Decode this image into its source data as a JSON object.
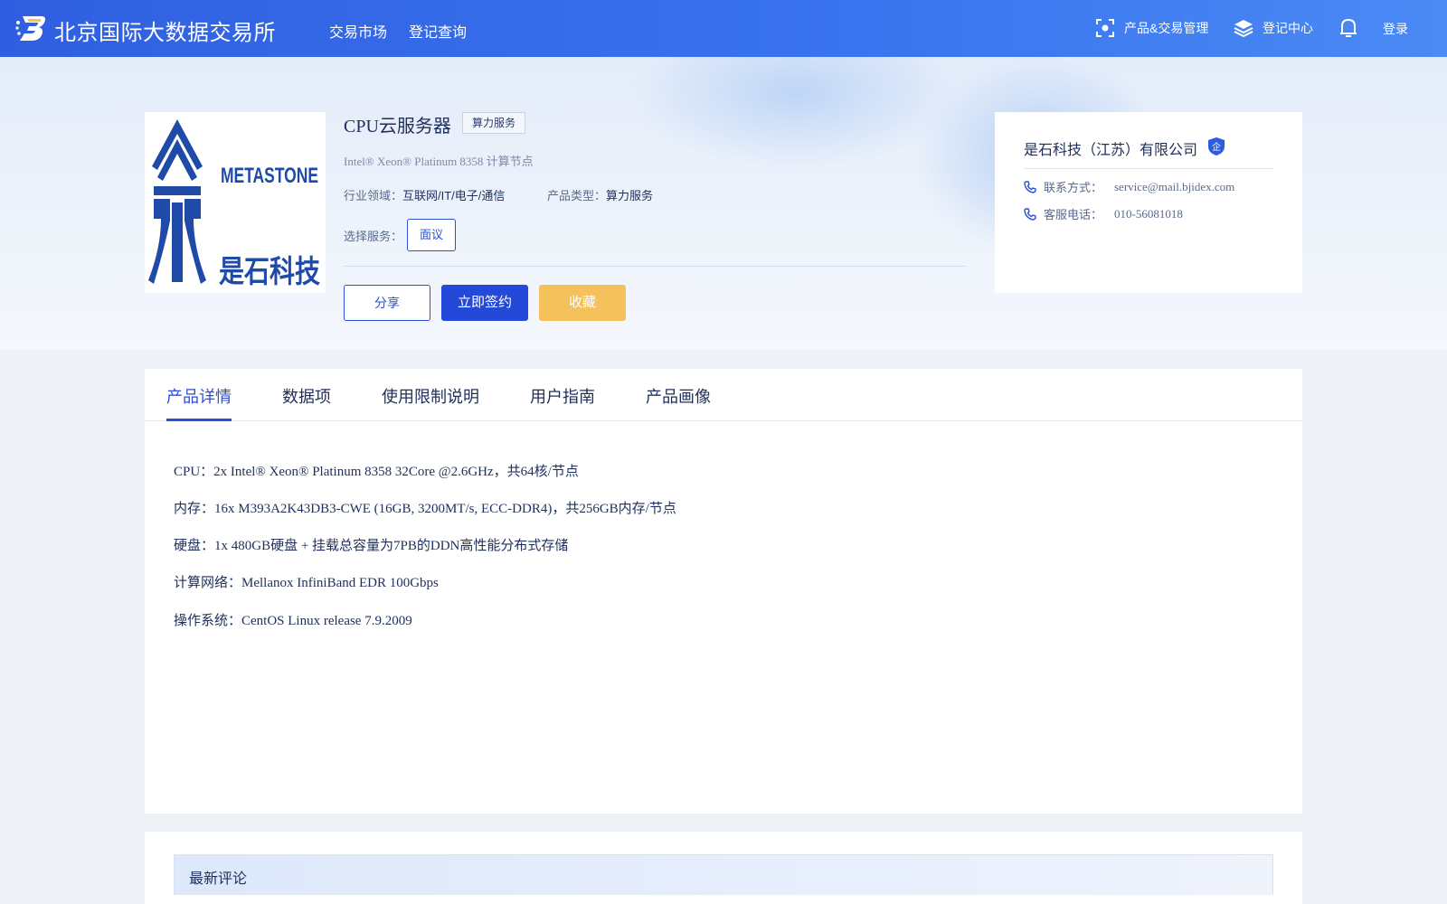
{
  "header": {
    "brand": "北京国际大数据交易所",
    "nav": [
      "交易市场",
      "登记查询"
    ],
    "right": {
      "product_trade_mgmt": "产品&交易管理",
      "registration_center": "登记中心",
      "login": "登录"
    },
    "icons": [
      "logo-b-icon",
      "scan-frame-icon",
      "layers-icon",
      "bell-icon"
    ]
  },
  "product": {
    "title": "CPU云服务器",
    "tag": "算力服务",
    "subtitle": "Intel® Xeon® Platinum 8358 计算节点",
    "industry_label": "行业领域：",
    "industry_value": "互联网/IT/电子/通信",
    "type_label": "产品类型：",
    "type_value": "算力服务",
    "service_label": "选择服务：",
    "service_option": "面议",
    "buttons": {
      "share": "分享",
      "sign": "立即签约",
      "favorite": "收藏"
    },
    "image_logo": {
      "line1": "METASTONE",
      "line2": "是石科技"
    }
  },
  "company": {
    "name": "是石科技（江苏）有限公司",
    "badge": "企",
    "contact_label": "联系方式：",
    "contact_value": "service@mail.bjidex.com",
    "phone_label": "客服电话：",
    "phone_value": "010-56081018"
  },
  "tabs": [
    "产品详情",
    "数据项",
    "使用限制说明",
    "用户指南",
    "产品画像"
  ],
  "active_tab": "产品详情",
  "specs": [
    "CPU：2x Intel® Xeon® Platinum 8358 32Core @2.6GHz，共64核/节点",
    "内存：16x M393A2K43DB3-CWE (16GB, 3200MT/s, ECC-DDR4)，共256GB内存/节点",
    "硬盘：1x 480GB硬盘 + 挂载总容量为7PB的DDN高性能分布式存储",
    "计算网络：Mellanox InfiniBand EDR 100Gbps",
    "操作系统：CentOS Linux release 7.9.2009"
  ],
  "comments": {
    "title": "最新评论"
  },
  "colors": {
    "primary": "#2a4fd6",
    "nav_bg": "#3a6fec",
    "favorite": "#f5c15a",
    "text": "#1f2f5b",
    "logo_blue": "#1f4aa8"
  }
}
